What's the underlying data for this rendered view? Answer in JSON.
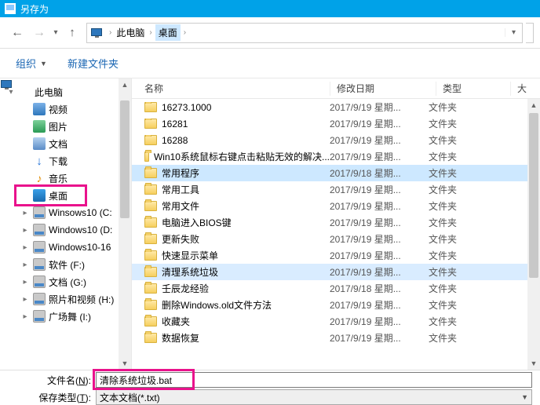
{
  "title": "另存为",
  "breadcrumb": {
    "root": "此电脑",
    "leaf": "桌面"
  },
  "cmdbar": {
    "organize": "组织",
    "newfolder": "新建文件夹"
  },
  "tree": [
    {
      "label": "此电脑",
      "icon": "pc",
      "depth": 0,
      "expander": "▾"
    },
    {
      "label": "视频",
      "icon": "video",
      "depth": 1,
      "expander": ""
    },
    {
      "label": "图片",
      "icon": "pic",
      "depth": 1,
      "expander": ""
    },
    {
      "label": "文档",
      "icon": "doc",
      "depth": 1,
      "expander": ""
    },
    {
      "label": "下载",
      "icon": "down",
      "depth": 1,
      "expander": ""
    },
    {
      "label": "音乐",
      "icon": "music",
      "depth": 1,
      "expander": ""
    },
    {
      "label": "桌面",
      "icon": "desk",
      "depth": 1,
      "expander": "",
      "selected": true
    },
    {
      "label": "Winsows10 (C:",
      "icon": "drive",
      "depth": 1,
      "expander": "▸"
    },
    {
      "label": "Windows10 (D:",
      "icon": "drive",
      "depth": 1,
      "expander": "▸"
    },
    {
      "label": "Windows10-16",
      "icon": "drive",
      "depth": 1,
      "expander": "▸"
    },
    {
      "label": "软件 (F:)",
      "icon": "drive",
      "depth": 1,
      "expander": "▸"
    },
    {
      "label": "文档 (G:)",
      "icon": "drive",
      "depth": 1,
      "expander": "▸"
    },
    {
      "label": "照片和视频 (H:)",
      "icon": "drive",
      "depth": 1,
      "expander": "▸"
    },
    {
      "label": "广场舞 (I:)",
      "icon": "drive",
      "depth": 1,
      "expander": "▸"
    }
  ],
  "list": {
    "columns": {
      "name": "名称",
      "date": "修改日期",
      "type": "类型",
      "size": "大"
    },
    "rows": [
      {
        "name": "16273.1000",
        "date": "2017/9/19 星期...",
        "type": "文件夹"
      },
      {
        "name": "16281",
        "date": "2017/9/19 星期...",
        "type": "文件夹"
      },
      {
        "name": "16288",
        "date": "2017/9/19 星期...",
        "type": "文件夹"
      },
      {
        "name": "Win10系统鼠标右键点击粘贴无效的解决...",
        "date": "2017/9/19 星期...",
        "type": "文件夹"
      },
      {
        "name": "常用程序",
        "date": "2017/9/18 星期...",
        "type": "文件夹",
        "sel": 1
      },
      {
        "name": "常用工具",
        "date": "2017/9/19 星期...",
        "type": "文件夹"
      },
      {
        "name": "常用文件",
        "date": "2017/9/19 星期...",
        "type": "文件夹"
      },
      {
        "name": "电脑进入BIOS键",
        "date": "2017/9/19 星期...",
        "type": "文件夹"
      },
      {
        "name": "更新失败",
        "date": "2017/9/19 星期...",
        "type": "文件夹"
      },
      {
        "name": "快速显示菜单",
        "date": "2017/9/19 星期...",
        "type": "文件夹"
      },
      {
        "name": "清理系统垃圾",
        "date": "2017/9/19 星期...",
        "type": "文件夹",
        "sel": 2
      },
      {
        "name": "壬辰龙经验",
        "date": "2017/9/18 星期...",
        "type": "文件夹"
      },
      {
        "name": "删除Windows.old文件方法",
        "date": "2017/9/19 星期...",
        "type": "文件夹"
      },
      {
        "name": "收藏夹",
        "date": "2017/9/19 星期...",
        "type": "文件夹"
      },
      {
        "name": "数据恢复",
        "date": "2017/9/19 星期...",
        "type": "文件夹"
      }
    ]
  },
  "footer": {
    "filename_label_pre": "文件名(",
    "filename_label_mn": "N",
    "filename_label_post": "):",
    "filename_value": "清除系统垃圾.bat",
    "filetype_label_pre": "保存类型(",
    "filetype_label_mn": "T",
    "filetype_label_post": "):",
    "filetype_value": "文本文档(*.txt)"
  }
}
